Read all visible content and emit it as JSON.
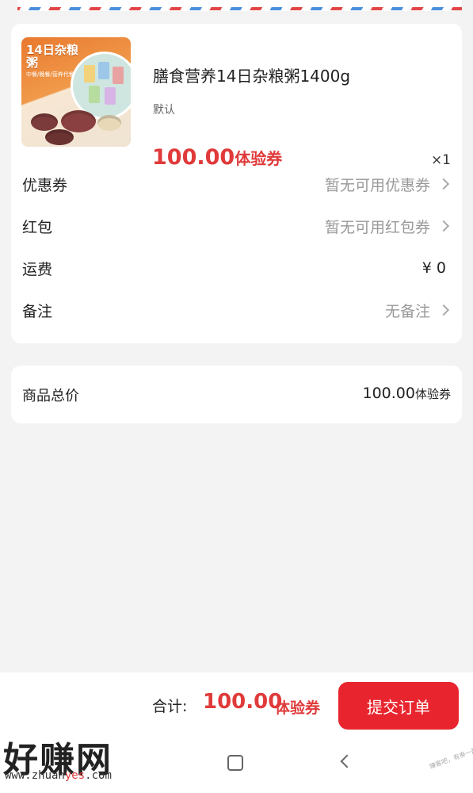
{
  "product": {
    "name": "膳食营养14日杂粮粥1400g",
    "spec": "默认",
    "price": "100.00",
    "price_unit": "体验券",
    "quantity": "×1",
    "thumb_title": "14日杂粮粥",
    "thumb_subtitle": "中餐/晚餐/营养代餐"
  },
  "rows": {
    "coupon": {
      "label": "优惠券",
      "value": "暂无可用优惠券"
    },
    "redpacket": {
      "label": "红包",
      "value": "暂无可用红包券"
    },
    "shipping": {
      "label": "运费",
      "value": "¥ 0"
    },
    "remark": {
      "label": "备注",
      "value": "无备注"
    }
  },
  "totals": {
    "label": "商品总价",
    "value": "100.00",
    "unit": "体验券"
  },
  "footer": {
    "sum_label": "合计:",
    "sum_value": "100.00",
    "sum_unit": "体验券",
    "submit_label": "提交订单"
  },
  "watermark": {
    "brand": "好赚网",
    "url_prefix": "www.zhuan",
    "url_highlight": "yes",
    "url_suffix": ".com",
    "stamp": "赚客吧，有券一起赚！"
  },
  "colors": {
    "accent": "#e03a3a",
    "button": "#e8252e",
    "background": "#f3f3f3"
  }
}
